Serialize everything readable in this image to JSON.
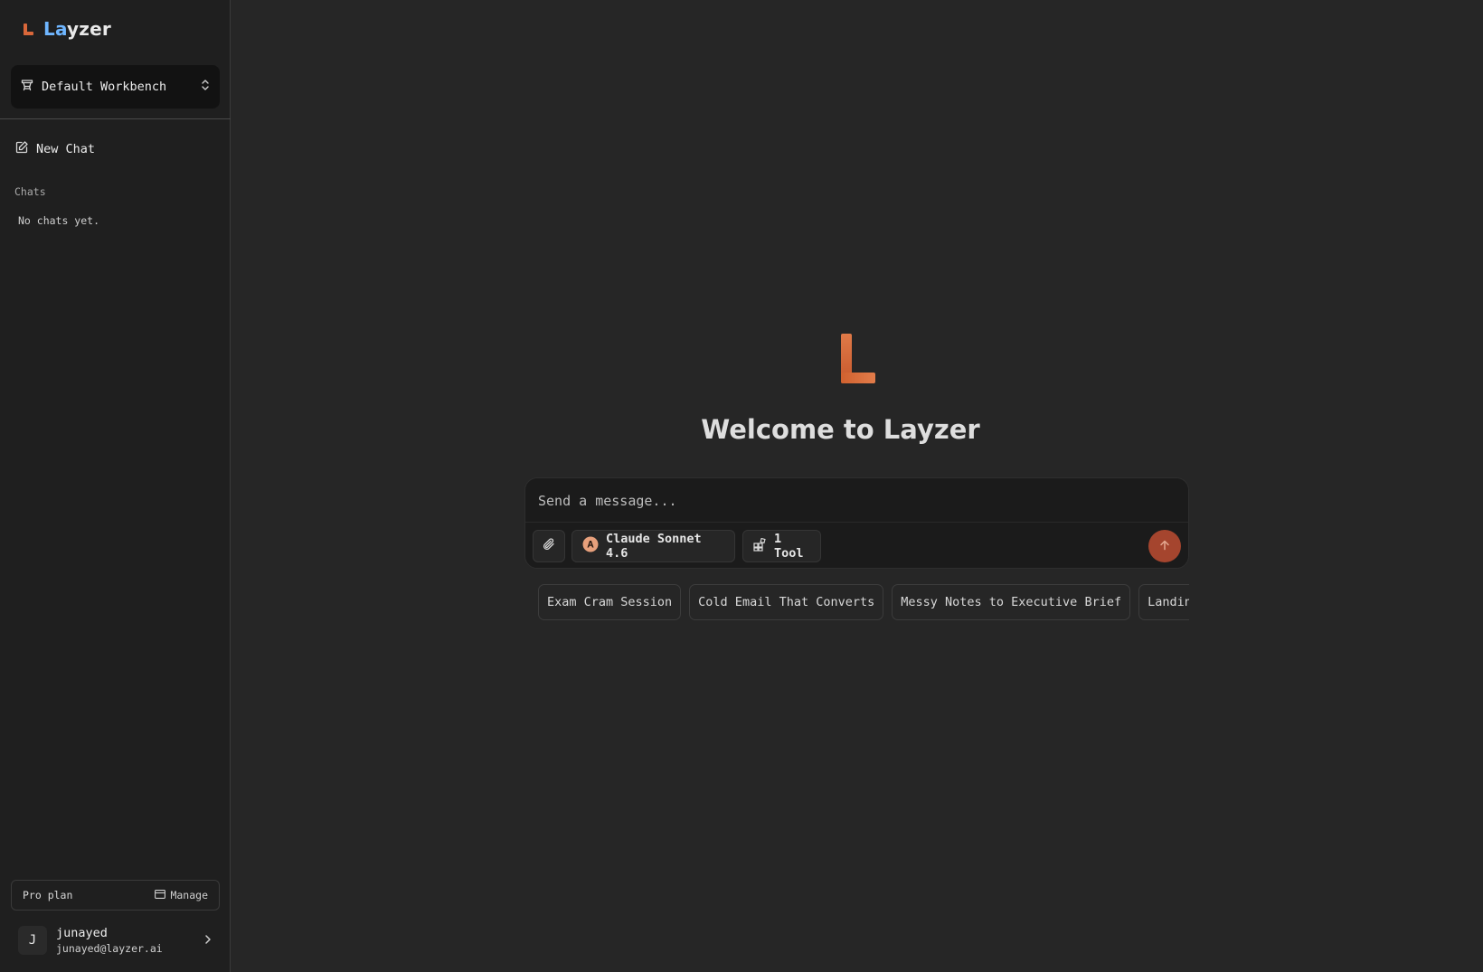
{
  "brand": {
    "name_part1": "La",
    "name_part2": "yzer"
  },
  "workbench": {
    "label": "Default Workbench"
  },
  "sidebar": {
    "new_chat_label": "New Chat",
    "chats_heading": "Chats",
    "empty_text": "No chats yet."
  },
  "plan": {
    "label": "Pro plan",
    "manage_label": "Manage"
  },
  "user": {
    "initial": "J",
    "name": "junayed",
    "email": "junayed@layzer.ai"
  },
  "main": {
    "welcome": "Welcome to Layzer",
    "input_placeholder": "Send a message...",
    "model_label": "Claude Sonnet 4.6",
    "tools_label": "1 Tool",
    "suggestions": [
      "Exam Cram Session",
      "Cold Email That Converts",
      "Messy Notes to Executive Brief",
      "Landing Page Copy"
    ]
  },
  "colors": {
    "accent": "#d9673a",
    "brand_highlight": "#6fb6ff",
    "send_button": "#a5452e",
    "background": "#262626",
    "sidebar": "#1f1f1f"
  }
}
